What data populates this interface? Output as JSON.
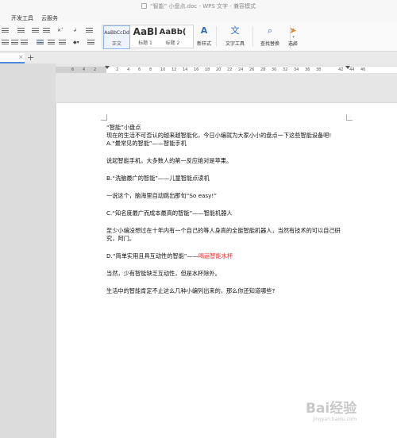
{
  "window": {
    "title": "“智能” 小盘点.doc - WPS 文字 - 兼容模式"
  },
  "menu": {
    "items": [
      "开发工具",
      "云服务"
    ]
  },
  "ribbon": {
    "styles": [
      {
        "preview": "AaBbCcDd",
        "label": "正文"
      },
      {
        "preview": "AaBl",
        "label": "标题 1"
      },
      {
        "preview": "AaBb(",
        "label": "标题 2"
      }
    ],
    "new_style_label": "新样式",
    "text_tools_label": "文字工具",
    "find_replace_label": "查找替换",
    "select_label": "选择"
  },
  "tabs": {
    "new_tab": "+"
  },
  "ruler": {
    "ticks": [
      "6",
      "4",
      "2",
      "",
      "2",
      "4",
      "6",
      "8",
      "10",
      "12",
      "14",
      "16",
      "18",
      "20",
      "22",
      "24",
      "26",
      "28",
      "30",
      "32",
      "34",
      "36",
      "38",
      "",
      "42",
      "44",
      "46"
    ]
  },
  "document": {
    "title_line": "“智能”小盘点",
    "intro": "现在的生活不可否认的越来越智能化，今日小编就为大家小小的盘点一下这些智能设备吧!",
    "a_heading": "A.“最常见的智能”——智能手机",
    "a_body": "说起智能手机，大多数人的第一反应绝对是苹果。",
    "b_heading": "B.“洗脑最广的智能”——儿童智能点读机",
    "b_body": "一说这个，脑海里自动跳出那句“So easy!”",
    "c_heading": "C.“知名度最广而成本最高的智能”——智能机器人",
    "c_body": "至少小编没想过在十年内有一个自己的等人身高的全能智能机器人，当然有技术的可以自己研究，阿门。",
    "d_heading_prefix": "D.“简单实用且具互动性的智能”——",
    "d_heading_red": "喝运智能水杯",
    "d_body": "当然，少有智能缺乏互动性，但是水杯除外。",
    "closing": "生活中的智能肯定不止这么几种小编列出来的，那么你还知道哪些?"
  },
  "watermark": {
    "text": "Bai经验",
    "sub": "jingyan.baidu.com"
  },
  "colors": {
    "accent": "#4b8ad6",
    "red_text": "#e03030"
  }
}
